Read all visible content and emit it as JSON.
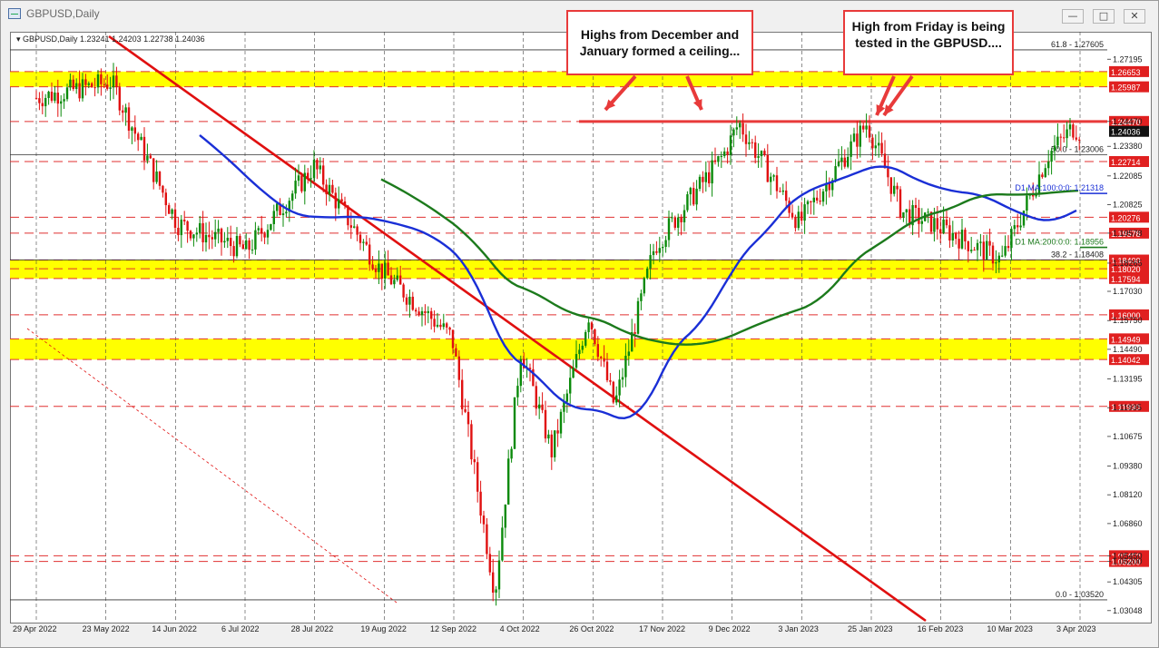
{
  "window": {
    "title": "GBPUSD,Daily",
    "minimize_icon": "minimize-icon",
    "maximize_icon": "maximize-icon",
    "close_icon": "close-icon"
  },
  "chart_header": {
    "symbol": "GBPUSD,Daily",
    "ohlc": "1.23241 1.24203 1.22738 1.24036"
  },
  "annotations": {
    "ceiling": "Highs from December and January formed a ceiling...",
    "friday": "High from Friday is being tested in the GBPUSD...."
  },
  "chart_data": {
    "type": "candlestick",
    "symbol": "GBPUSD",
    "timeframe": "Daily",
    "current_price": 1.24036,
    "current_price_label": "1.24036",
    "ylim": [
      1.03048,
      1.282
    ],
    "y_ticks": [
      "1.27195",
      "1.24470",
      "1.23380",
      "1.22085",
      "1.20825",
      "1.19578",
      "1.18265",
      "1.17030",
      "1.15750",
      "1.14490",
      "1.13195",
      "1.11935",
      "1.10675",
      "1.09380",
      "1.08120",
      "1.06860",
      "1.05450",
      "1.05200",
      "1.04305",
      "1.03048"
    ],
    "x_labels": [
      "29 Apr 2022",
      "23 May 2022",
      "14 Jun 2022",
      "6 Jul 2022",
      "28 Jul 2022",
      "19 Aug 2022",
      "12 Sep 2022",
      "4 Oct 2022",
      "26 Oct 2022",
      "17 Nov 2022",
      "9 Dec 2022",
      "3 Jan 2023",
      "25 Jan 2023",
      "16 Feb 2023",
      "10 Mar 2023",
      "3 Apr 2023"
    ],
    "price_path": [
      [
        "29 Apr 2022",
        1.255
      ],
      [
        "23 May 2022",
        1.262
      ],
      [
        "14 Jun 2022",
        1.2
      ],
      [
        "6 Jul 2022",
        1.188
      ],
      [
        "28 Jul 2022",
        1.225
      ],
      [
        "19 Aug 2022",
        1.18
      ],
      [
        "12 Sep 2022",
        1.15
      ],
      [
        "26 Sep 2022",
        1.038
      ],
      [
        "4 Oct 2022",
        1.145
      ],
      [
        "14 Oct 2022",
        1.1
      ],
      [
        "26 Oct 2022",
        1.16
      ],
      [
        "4 Nov 2022",
        1.12
      ],
      [
        "17 Nov 2022",
        1.19
      ],
      [
        "9 Dec 2022",
        1.23
      ],
      [
        "14 Dec 2022",
        1.244
      ],
      [
        "3 Jan 2023",
        1.2
      ],
      [
        "25 Jan 2023",
        1.244
      ],
      [
        "6 Feb 2023",
        1.205
      ],
      [
        "16 Feb 2023",
        1.2
      ],
      [
        "8 Mar 2023",
        1.184
      ],
      [
        "23 Mar 2023",
        1.23
      ],
      [
        "31 Mar 2023",
        1.242
      ],
      [
        "3 Apr 2023",
        1.2404
      ]
    ],
    "support_levels": [
      {
        "label": "1.26653",
        "value": 1.26653,
        "zone": true
      },
      {
        "label": "1.25987",
        "value": 1.25987,
        "zone": true
      },
      {
        "label": "1.24470",
        "value": 1.2447,
        "zone": false
      },
      {
        "label": "1.22714",
        "value": 1.22714,
        "zone": false
      },
      {
        "label": "1.20276",
        "value": 1.20276,
        "zone": false
      },
      {
        "label": "1.19578",
        "value": 1.19578,
        "zone": false
      },
      {
        "label": "1.18400",
        "value": 1.184,
        "zone": true
      },
      {
        "label": "1.18020",
        "value": 1.1802,
        "zone": true
      },
      {
        "label": "1.17594",
        "value": 1.17594,
        "zone": true
      },
      {
        "label": "1.16000",
        "value": 1.16,
        "zone": false
      },
      {
        "label": "1.14949",
        "value": 1.14949,
        "zone": true
      },
      {
        "label": "1.14042",
        "value": 1.14042,
        "zone": true
      },
      {
        "label": "1.11990",
        "value": 1.1199,
        "zone": false
      },
      {
        "label": "1.05450",
        "value": 1.0545,
        "zone": false
      },
      {
        "label": "1.05200",
        "value": 1.052,
        "zone": false
      }
    ],
    "fib_levels": [
      {
        "label": "61.8 - 1.27605",
        "value": 1.27605
      },
      {
        "label": "50.0 - 1.23006",
        "value": 1.23006
      },
      {
        "label": "38.2 - 1.18408",
        "value": 1.18408
      },
      {
        "label": "0.0 - 1.03520",
        "value": 1.0352
      }
    ],
    "moving_averages": [
      {
        "name": "D1 MA:100:0:0: 1.21318",
        "value": 1.21318,
        "color": "#1a2fd6"
      },
      {
        "name": "D1 MA:200:0:0: 1.18956",
        "value": 1.18956,
        "color": "#1c7a1c"
      }
    ],
    "ceiling_level": 1.2447,
    "colors": {
      "bull": "#0a8a0a",
      "bear": "#e01010",
      "zone": "#ffff00",
      "level": "#e03030",
      "ma100": "#1a2fd6",
      "ma200": "#1c7a1c",
      "trend": "#e01010"
    }
  }
}
